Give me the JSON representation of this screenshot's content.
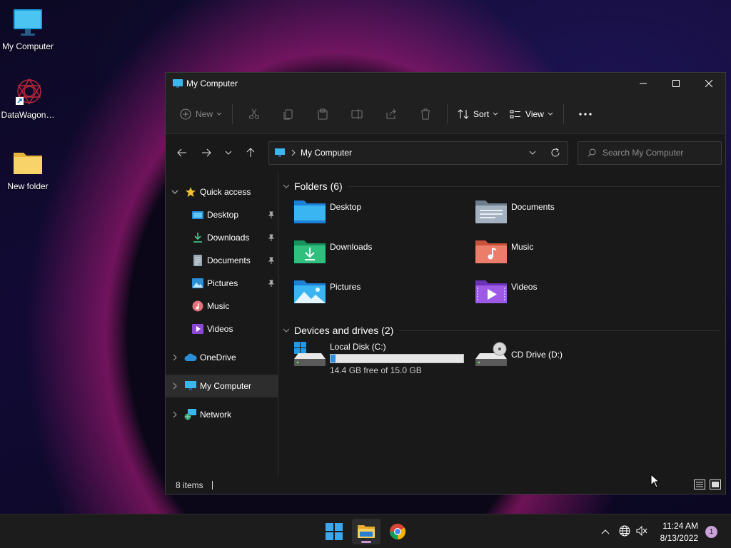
{
  "desktop": {
    "icons": [
      {
        "label": "My Computer",
        "icon": "monitor-icon"
      },
      {
        "label": "DataWagon…",
        "icon": "datawagon-shortcut-icon"
      },
      {
        "label": "New folder",
        "icon": "folder-icon"
      }
    ]
  },
  "window": {
    "title": "My Computer",
    "controls": [
      "minimize",
      "maximize",
      "close"
    ]
  },
  "toolbar": {
    "new_label": "New",
    "sort_label": "Sort",
    "view_label": "View",
    "more_label": "…"
  },
  "address": {
    "crumb": "My Computer"
  },
  "search": {
    "placeholder": "Search My Computer"
  },
  "sidebar": {
    "quick_access": "Quick access",
    "pinned": [
      {
        "label": "Desktop",
        "pinned": true
      },
      {
        "label": "Downloads",
        "pinned": true
      },
      {
        "label": "Documents",
        "pinned": true
      },
      {
        "label": "Pictures",
        "pinned": true
      },
      {
        "label": "Music",
        "pinned": false
      },
      {
        "label": "Videos",
        "pinned": false
      }
    ],
    "onedrive": "OneDrive",
    "my_computer": "My Computer",
    "network": "Network"
  },
  "content": {
    "folders_header": "Folders (6)",
    "folders": [
      {
        "name": "Desktop"
      },
      {
        "name": "Documents"
      },
      {
        "name": "Downloads"
      },
      {
        "name": "Music"
      },
      {
        "name": "Pictures"
      },
      {
        "name": "Videos"
      }
    ],
    "devices_header": "Devices and drives (2)",
    "drives": [
      {
        "name": "Local Disk (C:)",
        "free_text": "14.4 GB free of 15.0 GB",
        "used_fraction": 0.04
      },
      {
        "name": "CD Drive (D:)"
      }
    ]
  },
  "status": {
    "items": "8 items"
  },
  "taskbar": {
    "time": "11:24 AM",
    "date": "8/13/2022",
    "notifications": "1"
  },
  "colors": {
    "accent": "#2f8fe0",
    "window_bg": "#191919",
    "taskbar_bg": "#1c1c1c"
  }
}
